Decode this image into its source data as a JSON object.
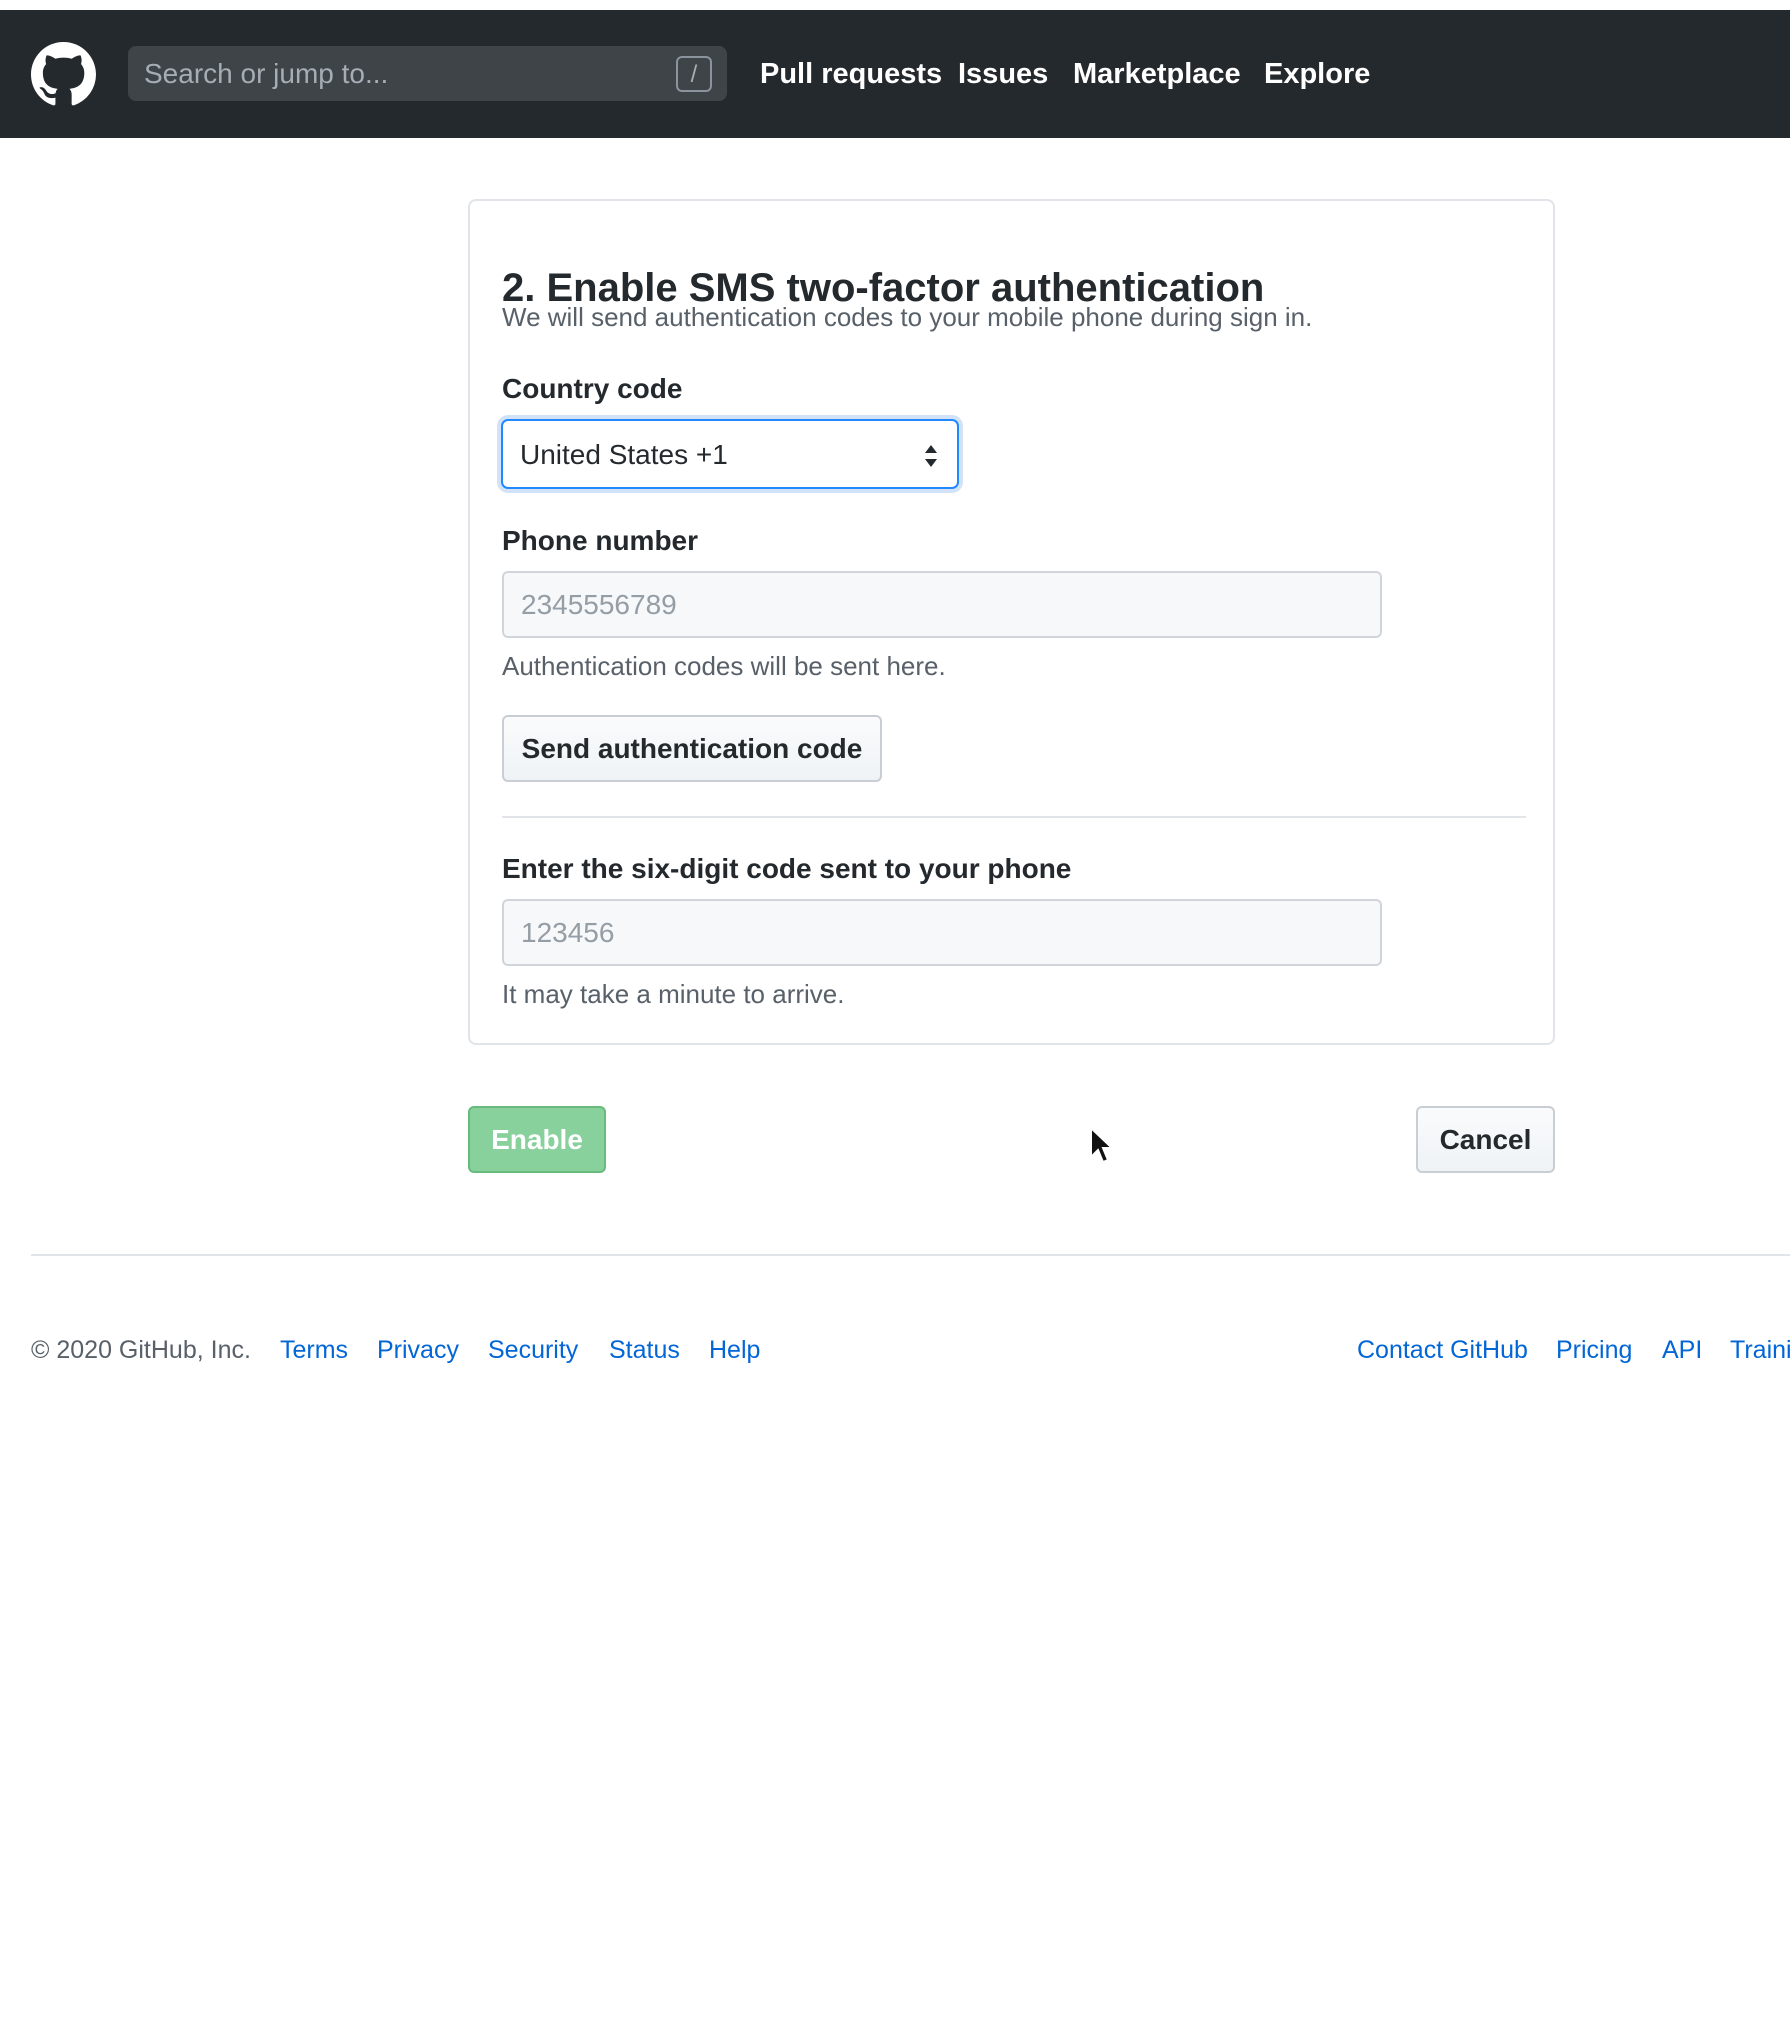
{
  "header": {
    "search": {
      "placeholder": "Search or jump to...",
      "shortcut": "/"
    },
    "nav": [
      {
        "label": "Pull requests"
      },
      {
        "label": "Issues"
      },
      {
        "label": "Marketplace"
      },
      {
        "label": "Explore"
      }
    ],
    "logo_icon": "github-octocat-icon"
  },
  "setup": {
    "title": "2. Enable SMS two-factor authentication",
    "description": "We will send authentication codes to your mobile phone during sign in.",
    "country": {
      "label": "Country code",
      "selected": "United States +1",
      "icon": "select-arrows-icon"
    },
    "phone": {
      "label": "Phone number",
      "placeholder": "2345556789",
      "helper": "Authentication codes will be sent here."
    },
    "send_button": "Send authentication code",
    "code": {
      "label": "Enter the six-digit code sent to your phone",
      "placeholder": "123456",
      "helper": "It may take a minute to arrive."
    }
  },
  "actions": {
    "enable": "Enable",
    "cancel": "Cancel"
  },
  "footer": {
    "copyright": "© 2020 GitHub, Inc.",
    "left_links": [
      {
        "label": "Terms"
      },
      {
        "label": "Privacy"
      },
      {
        "label": "Security"
      },
      {
        "label": "Status"
      },
      {
        "label": "Help"
      }
    ],
    "right_links": [
      {
        "label": "Contact GitHub"
      },
      {
        "label": "Pricing"
      },
      {
        "label": "API"
      },
      {
        "label": "Traini"
      }
    ]
  },
  "colors": {
    "header_background": "#24292e",
    "primary_button": "#7ccc92",
    "link": "#0366d6",
    "focus": "#2188ff"
  },
  "cursor_icon": "mouse-pointer-icon"
}
